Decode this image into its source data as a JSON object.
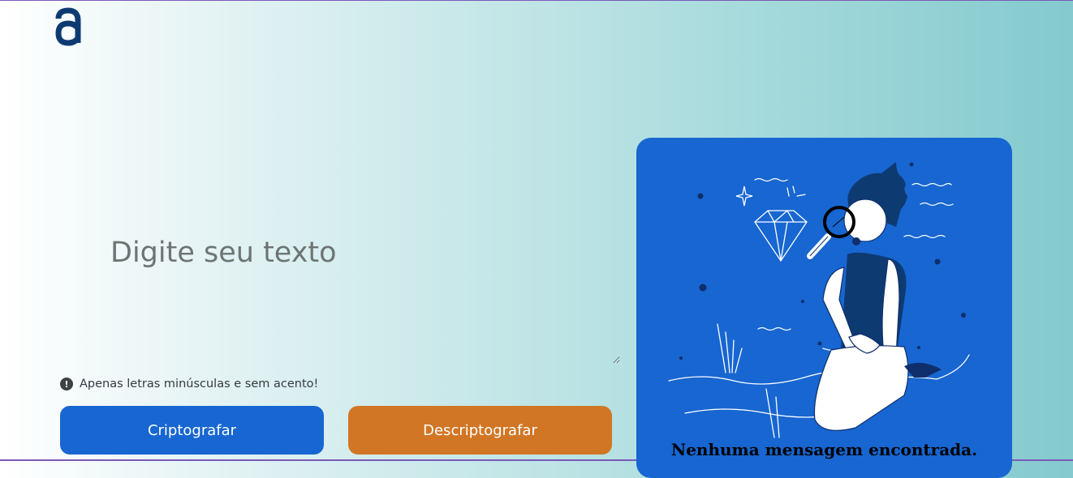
{
  "header": {
    "logo_icon": "alura-a-logo-icon",
    "brand_color": "#0e3a72"
  },
  "input": {
    "placeholder": "Digite seu texto",
    "value": ""
  },
  "hint": {
    "icon": "exclamation-circle-icon",
    "text": "Apenas letras minúsculas e sem acento!"
  },
  "actions": {
    "encrypt_label": "Criptografar",
    "decrypt_label": "Descriptografar",
    "encrypt_color": "#1766d1",
    "decrypt_color": "#d17624"
  },
  "output": {
    "illustration": "person-with-magnifying-glass-illustration",
    "empty_message": "Nenhuma mensagem encontrada.",
    "panel_color": "#1766d1"
  }
}
